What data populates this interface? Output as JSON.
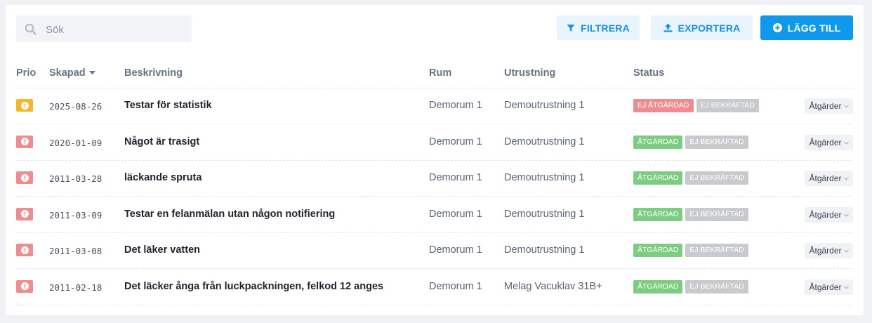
{
  "search": {
    "placeholder": "Sök",
    "value": ""
  },
  "toolbar": {
    "filter_label": "FILTRERA",
    "export_label": "EXPORTERA",
    "add_label": "LÄGG TILL"
  },
  "colors": {
    "primary": "#0f99ec",
    "prio_medium": "#f7b52c",
    "prio_high": "#ee8d91",
    "status_open": "#ee8d91",
    "status_done": "#7ccc82",
    "status_unconfirmed": "#c8cacd"
  },
  "table": {
    "columns": {
      "prio": "Prio",
      "created": "Skapad",
      "description": "Beskrivning",
      "room": "Rum",
      "equipment": "Utrustning",
      "status": "Status"
    },
    "sort_column": "created",
    "sort_direction": "desc",
    "action_label": "Åtgärder",
    "rows": [
      {
        "prio": "medium",
        "created": "2025-08-26",
        "description": "Testar för statistik",
        "room": "Demorum 1",
        "equipment": "Demoutrustning 1",
        "status": "EJ ÅTGÄRDAD",
        "status_kind": "open",
        "confirmation": "EJ BEKRÄFTAD"
      },
      {
        "prio": "high",
        "created": "2020-01-09",
        "description": "Något är trasigt",
        "room": "Demorum 1",
        "equipment": "Demoutrustning 1",
        "status": "ÅTGÄRDAD",
        "status_kind": "done",
        "confirmation": "EJ BEKRÄFTAD"
      },
      {
        "prio": "high",
        "created": "2011-03-28",
        "description": "läckande spruta",
        "room": "Demorum 1",
        "equipment": "Demoutrustning 1",
        "status": "ÅTGÄRDAD",
        "status_kind": "done",
        "confirmation": "EJ BEKRÄFTAD"
      },
      {
        "prio": "high",
        "created": "2011-03-09",
        "description": "Testar en felanmälan utan någon notifiering",
        "room": "Demorum 1",
        "equipment": "Demoutrustning 1",
        "status": "ÅTGÄRDAD",
        "status_kind": "done",
        "confirmation": "EJ BEKRÄFTAD"
      },
      {
        "prio": "high",
        "created": "2011-03-08",
        "description": "Det läker vatten",
        "room": "Demorum 1",
        "equipment": "Demoutrustning 1",
        "status": "ÅTGÄRDAD",
        "status_kind": "done",
        "confirmation": "EJ BEKRÄFTAD"
      },
      {
        "prio": "high",
        "created": "2011-02-18",
        "description": "Det läcker ånga från luckpackningen, felkod 12 anges",
        "room": "Demorum 1",
        "equipment": "Melag Vacuklav 31B+",
        "status": "ÅTGÄRDAD",
        "status_kind": "done",
        "confirmation": "EJ BEKRÄFTAD"
      }
    ]
  }
}
